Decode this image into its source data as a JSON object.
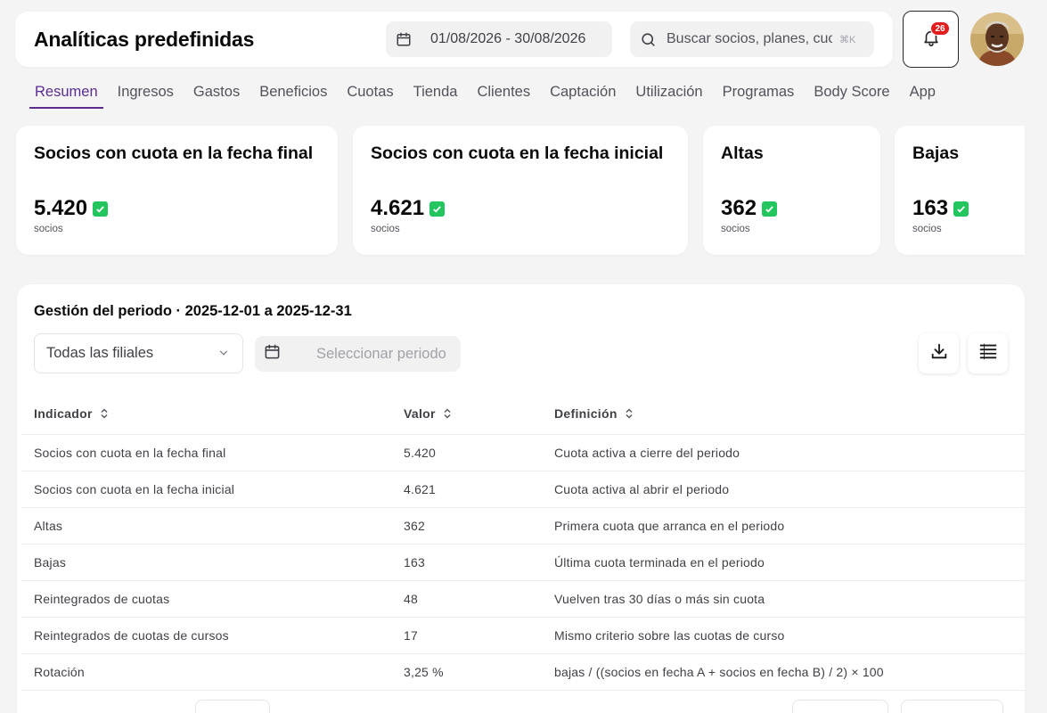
{
  "header": {
    "title": "Analíticas predefinidas",
    "date_range": "01/08/2026 - 30/08/2026",
    "search_placeholder": "Buscar socios, planes, cuotas",
    "search_shortcut": "⌘K",
    "notifications_count": "26"
  },
  "tabs": [
    {
      "label": "Resumen",
      "active": true
    },
    {
      "label": "Ingresos"
    },
    {
      "label": "Gastos"
    },
    {
      "label": "Beneficios"
    },
    {
      "label": "Cuotas"
    },
    {
      "label": "Tienda"
    },
    {
      "label": "Clientes"
    },
    {
      "label": "Captación"
    },
    {
      "label": "Utilización"
    },
    {
      "label": "Programas"
    },
    {
      "label": "Body Score"
    },
    {
      "label": "App"
    }
  ],
  "kpis": [
    {
      "title": "Socios con cuota en la fecha final",
      "value": "5.420",
      "unit": "socios"
    },
    {
      "title": "Socios con cuota en la fecha inicial",
      "value": "4.621",
      "unit": "socios"
    },
    {
      "title": "Altas",
      "value": "362",
      "unit": "socios"
    },
    {
      "title": "Bajas",
      "value": "163",
      "unit": "socios"
    }
  ],
  "panel": {
    "title": "Gestión del periodo · 2025-12-01 a 2025-12-31",
    "filial_select": "Todas las filiales",
    "period_placeholder": "Seleccionar periodo",
    "columns": [
      "Indicador",
      "Valor",
      "Definición"
    ],
    "rows": [
      {
        "indicador": "Socios con cuota en la fecha final",
        "valor": "5.420",
        "definicion": "Cuota activa a cierre del periodo"
      },
      {
        "indicador": "Socios con cuota en la fecha inicial",
        "valor": "4.621",
        "definicion": "Cuota activa al abrir el periodo"
      },
      {
        "indicador": "Altas",
        "valor": "362",
        "definicion": "Primera cuota que arranca en el periodo"
      },
      {
        "indicador": "Bajas",
        "valor": "163",
        "definicion": "Última cuota terminada en el periodo"
      },
      {
        "indicador": "Reintegrados de cuotas",
        "valor": "48",
        "definicion": "Vuelven tras 30 días o más sin cuota"
      },
      {
        "indicador": "Reintegrados de cuotas de cursos",
        "valor": "17",
        "definicion": "Mismo criterio sobre las cuotas de curso"
      },
      {
        "indicador": "Rotación",
        "valor": "3,25 %",
        "definicion": "bajas / ((socios en fecha A + socios en fecha B) / 2) × 100"
      }
    ]
  },
  "colors": {
    "accent": "#5b2d8e",
    "check": "#22c55e",
    "badge": "#e11d1d",
    "background": "#f4f4f5"
  }
}
